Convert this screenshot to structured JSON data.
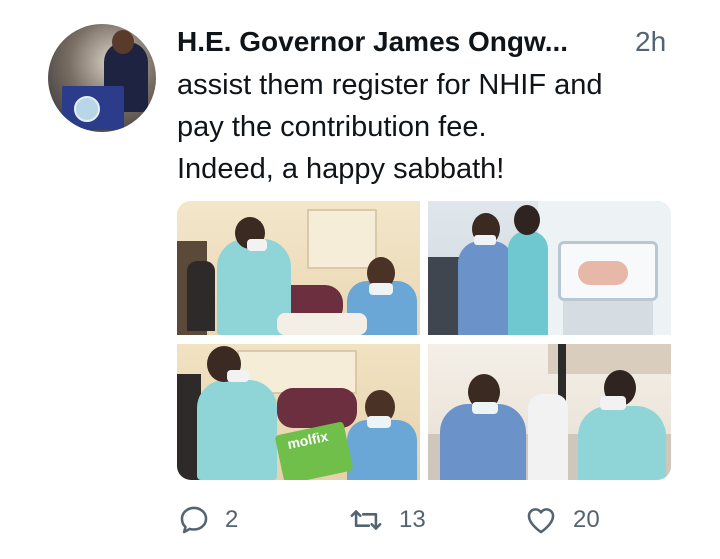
{
  "tweet": {
    "author_name": "H.E. Governor James Ongw...",
    "timestamp": "2h",
    "text_lines": [
      "assist them register for NHIF and",
      "pay the contribution fee.",
      "Indeed, a happy sabbath!"
    ],
    "media_label": "molfix"
  },
  "actions": {
    "replies": "2",
    "retweets": "13",
    "likes": "20"
  },
  "icons": {
    "reply": "reply-icon",
    "retweet": "retweet-icon",
    "like": "heart-icon"
  },
  "colors": {
    "text": "#0f1419",
    "secondary": "#536471",
    "accent_turquoise": "#4fc7d0"
  }
}
